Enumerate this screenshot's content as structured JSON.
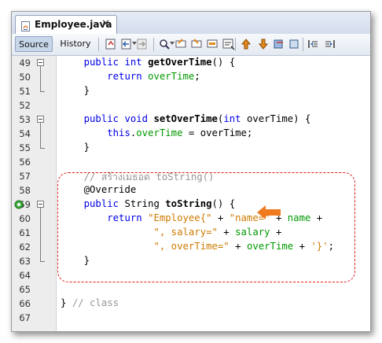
{
  "tab": {
    "title": "Employee.java",
    "close": "✕"
  },
  "toolbar": {
    "source_label": "Source",
    "history_label": "History",
    "icons": [
      "last-edit-icon",
      "back-icon",
      "forward-icon",
      "find-icon",
      "find-previous-icon",
      "find-next-icon",
      "find-selection-icon",
      "toggle-highlight-icon",
      "toggle-rectangular-selection-icon",
      "previous-bookmark-icon",
      "next-bookmark-icon",
      "toggle-bookmark-icon",
      "shift-left-icon",
      "shift-right-icon"
    ]
  },
  "colors": {
    "keyword": "#0000e6",
    "field": "#009900",
    "string": "#ce7b00",
    "comment": "#969696",
    "highlight_box": "#e11b1b",
    "arrow": "#f07a1e"
  },
  "editor": {
    "lines": [
      {
        "n": "49",
        "segments": [
          [
            "",
            "    "
          ],
          [
            "kw",
            "public int "
          ],
          [
            "fn",
            "getOverTime"
          ],
          [
            "",
            "() {"
          ]
        ]
      },
      {
        "n": "50",
        "segments": [
          [
            "",
            "        "
          ],
          [
            "kw",
            "return "
          ],
          [
            "fld",
            "overTime"
          ],
          [
            "",
            ";"
          ]
        ]
      },
      {
        "n": "51",
        "segments": [
          [
            "",
            "    }"
          ]
        ]
      },
      {
        "n": "52",
        "segments": []
      },
      {
        "n": "53",
        "segments": [
          [
            "",
            "    "
          ],
          [
            "kw",
            "public void "
          ],
          [
            "fn",
            "setOverTime"
          ],
          [
            "",
            "("
          ],
          [
            "kw",
            "int "
          ],
          [
            "",
            "overTime) {"
          ]
        ]
      },
      {
        "n": "54",
        "segments": [
          [
            "",
            "        "
          ],
          [
            "kw",
            "this"
          ],
          [
            "",
            "."
          ],
          [
            "fld",
            "overTime"
          ],
          [
            "",
            " = overTime;"
          ]
        ]
      },
      {
        "n": "55",
        "segments": [
          [
            "",
            "    }"
          ]
        ]
      },
      {
        "n": "56",
        "segments": []
      },
      {
        "n": "57",
        "segments": [
          [
            "",
            "    "
          ],
          [
            "cmt",
            "// สร้างเมธอด toString()"
          ]
        ]
      },
      {
        "n": "58",
        "segments": [
          [
            "",
            "    "
          ],
          [
            "ann",
            "@Override"
          ]
        ]
      },
      {
        "n": "59",
        "segments": [
          [
            "",
            "    "
          ],
          [
            "kw",
            "public "
          ],
          [
            "",
            "String "
          ],
          [
            "fn",
            "toString"
          ],
          [
            "",
            "() {"
          ]
        ]
      },
      {
        "n": "60",
        "segments": [
          [
            "",
            "        "
          ],
          [
            "kw",
            "return "
          ],
          [
            "str",
            "\"Employee{\""
          ],
          [
            "",
            " + "
          ],
          [
            "str",
            "\"name=\""
          ],
          [
            "",
            " + "
          ],
          [
            "fld",
            "name"
          ],
          [
            "",
            " +"
          ]
        ]
      },
      {
        "n": "61",
        "segments": [
          [
            "",
            "                "
          ],
          [
            "str",
            "\", salary=\""
          ],
          [
            "",
            " + "
          ],
          [
            "fld",
            "salary"
          ],
          [
            "",
            " +"
          ]
        ]
      },
      {
        "n": "62",
        "segments": [
          [
            "",
            "                "
          ],
          [
            "str",
            "\", overTime=\""
          ],
          [
            "",
            " + "
          ],
          [
            "fld",
            "overTime"
          ],
          [
            "",
            " + "
          ],
          [
            "str",
            "'}'"
          ],
          [
            "",
            ";"
          ]
        ]
      },
      {
        "n": "63",
        "segments": [
          [
            "",
            "    }"
          ]
        ]
      },
      {
        "n": "64",
        "segments": []
      },
      {
        "n": "65",
        "segments": []
      },
      {
        "n": "66",
        "segments": [
          [
            "",
            "} "
          ],
          [
            "cmt",
            "// class"
          ]
        ]
      },
      {
        "n": "67",
        "segments": []
      }
    ]
  }
}
